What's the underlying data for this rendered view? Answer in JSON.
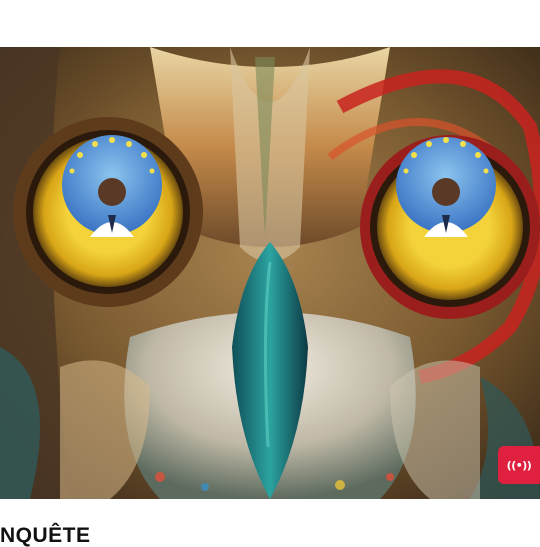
{
  "hero": {
    "image_icon": "owl-eyes-illustration"
  },
  "live_button": {
    "icon": "broadcast-icon",
    "glyph": "((•))",
    "color": "#e0203f"
  },
  "section": {
    "label": "NQUÊTE"
  }
}
